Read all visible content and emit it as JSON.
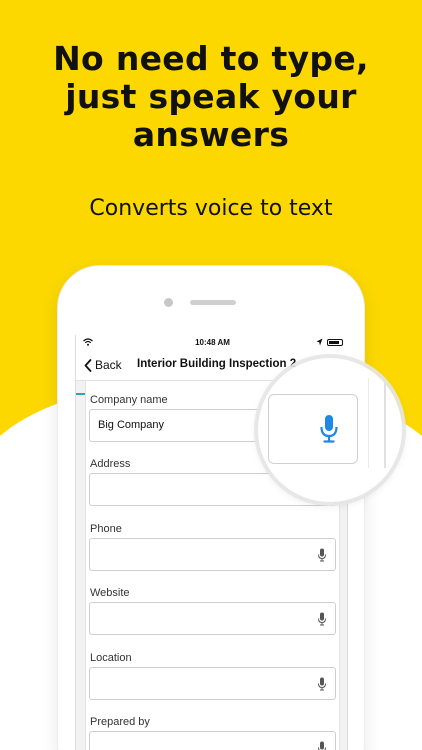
{
  "promo": {
    "headline_lines": [
      "No need to type,",
      "just speak your",
      "answers"
    ],
    "subline": "Converts voice to text",
    "background_color": "#FCD800"
  },
  "statusbar": {
    "time": "10:48 AM"
  },
  "navbar": {
    "back_label": "Back",
    "title": "Interior Building Inspection 2"
  },
  "fields": [
    {
      "label": "Company name",
      "value": "Big Company"
    },
    {
      "label": "Address",
      "value": ""
    },
    {
      "label": "Phone",
      "value": ""
    },
    {
      "label": "Website",
      "value": ""
    },
    {
      "label": "Location",
      "value": ""
    },
    {
      "label": "Prepared by",
      "value": ""
    }
  ],
  "icons": {
    "mic": "microphone-icon",
    "back": "chevron-left-icon"
  },
  "accent_colors": {
    "mic_blue": "#1E88E5",
    "tab_indicator": "#2AA6B4"
  }
}
